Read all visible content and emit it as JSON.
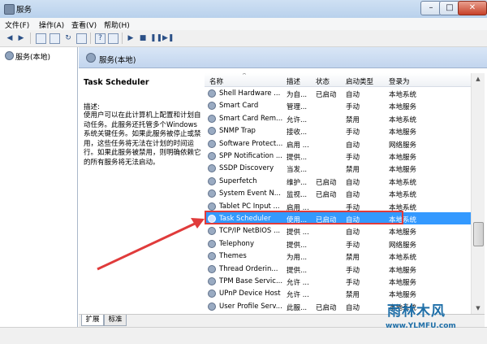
{
  "window": {
    "title": "服务",
    "min_glyph": "–",
    "max_glyph": "□",
    "close_glyph": "✕"
  },
  "menu": [
    "文件(F)",
    "操作(A)",
    "查看(V)",
    "帮助(H)"
  ],
  "toolbar": {
    "icons": [
      "back-arrow",
      "forward-arrow",
      "console-tree",
      "properties",
      "refresh",
      "export-list",
      "help",
      "details",
      "play",
      "stop",
      "pause",
      "restart"
    ],
    "glyphs": [
      "◀",
      "▶",
      "",
      "",
      "↻",
      "",
      "?",
      "",
      "▶",
      "■",
      "❚❚",
      "▶❚"
    ]
  },
  "tree": {
    "item": "服务(本地)"
  },
  "panel": {
    "header": "服务(本地)"
  },
  "description": {
    "service_name": "Task Scheduler",
    "label": "描述:",
    "text": "使用户可以在此计算机上配置和计划自动任务。此服务还托管多个Windows 系统关键任务。如果此服务被停止或禁用，这些任务将无法在计划的时间运行。如果此服务被禁用，则明确依赖它的所有服务将无法启动。"
  },
  "columns": {
    "name": "名称",
    "desc": "描述",
    "status": "状态",
    "startup": "启动类型",
    "logon": "登录为",
    "sort_glyph": "^"
  },
  "rows": [
    {
      "name": "Shell Hardware ...",
      "desc": "为自...",
      "status": "已启动",
      "startup": "自动",
      "logon": "本地系统"
    },
    {
      "name": "Smart Card",
      "desc": "管理...",
      "status": "",
      "startup": "手动",
      "logon": "本地服务"
    },
    {
      "name": "Smart Card Rem...",
      "desc": "允许...",
      "status": "",
      "startup": "禁用",
      "logon": "本地系统"
    },
    {
      "name": "SNMP Trap",
      "desc": "接收...",
      "status": "",
      "startup": "手动",
      "logon": "本地服务"
    },
    {
      "name": "Software Protect...",
      "desc": "启用 ...",
      "status": "",
      "startup": "自动",
      "logon": "网络服务"
    },
    {
      "name": "SPP Notification ...",
      "desc": "提供...",
      "status": "",
      "startup": "手动",
      "logon": "本地服务"
    },
    {
      "name": "SSDP Discovery",
      "desc": "当发...",
      "status": "",
      "startup": "禁用",
      "logon": "本地服务"
    },
    {
      "name": "Superfetch",
      "desc": "维护...",
      "status": "已启动",
      "startup": "自动",
      "logon": "本地系统"
    },
    {
      "name": "System Event N...",
      "desc": "监视...",
      "status": "已启动",
      "startup": "自动",
      "logon": "本地系统"
    },
    {
      "name": "Tablet PC Input ...",
      "desc": "启用 ...",
      "status": "",
      "startup": "手动",
      "logon": "本地系统"
    },
    {
      "name": "Task Scheduler",
      "desc": "使用...",
      "status": "已启动",
      "startup": "自动",
      "logon": "本地系统"
    },
    {
      "name": "TCP/IP NetBIOS ...",
      "desc": "提供 ...",
      "status": "",
      "startup": "自动",
      "logon": "本地服务"
    },
    {
      "name": "Telephony",
      "desc": "提供...",
      "status": "",
      "startup": "手动",
      "logon": "网络服务"
    },
    {
      "name": "Themes",
      "desc": "为用...",
      "status": "",
      "startup": "禁用",
      "logon": "本地系统"
    },
    {
      "name": "Thread Orderin...",
      "desc": "提供...",
      "status": "",
      "startup": "手动",
      "logon": "本地服务"
    },
    {
      "name": "TPM Base Servic...",
      "desc": "允许 ...",
      "status": "",
      "startup": "手动",
      "logon": "本地服务"
    },
    {
      "name": "UPnP Device Host",
      "desc": "允许 ...",
      "status": "",
      "startup": "禁用",
      "logon": "本地服务"
    },
    {
      "name": "User Profile Serv...",
      "desc": "此服...",
      "status": "已启动",
      "startup": "自动",
      "logon": "本地系统"
    }
  ],
  "selected_row": "Task Scheduler",
  "tabs": [
    "扩展",
    "标准"
  ],
  "watermark": {
    "logo": "雨林木风",
    "url": "www.YLMFU.com"
  },
  "colors": {
    "selection": "#3399ff",
    "annotation": "#e03b3b"
  }
}
